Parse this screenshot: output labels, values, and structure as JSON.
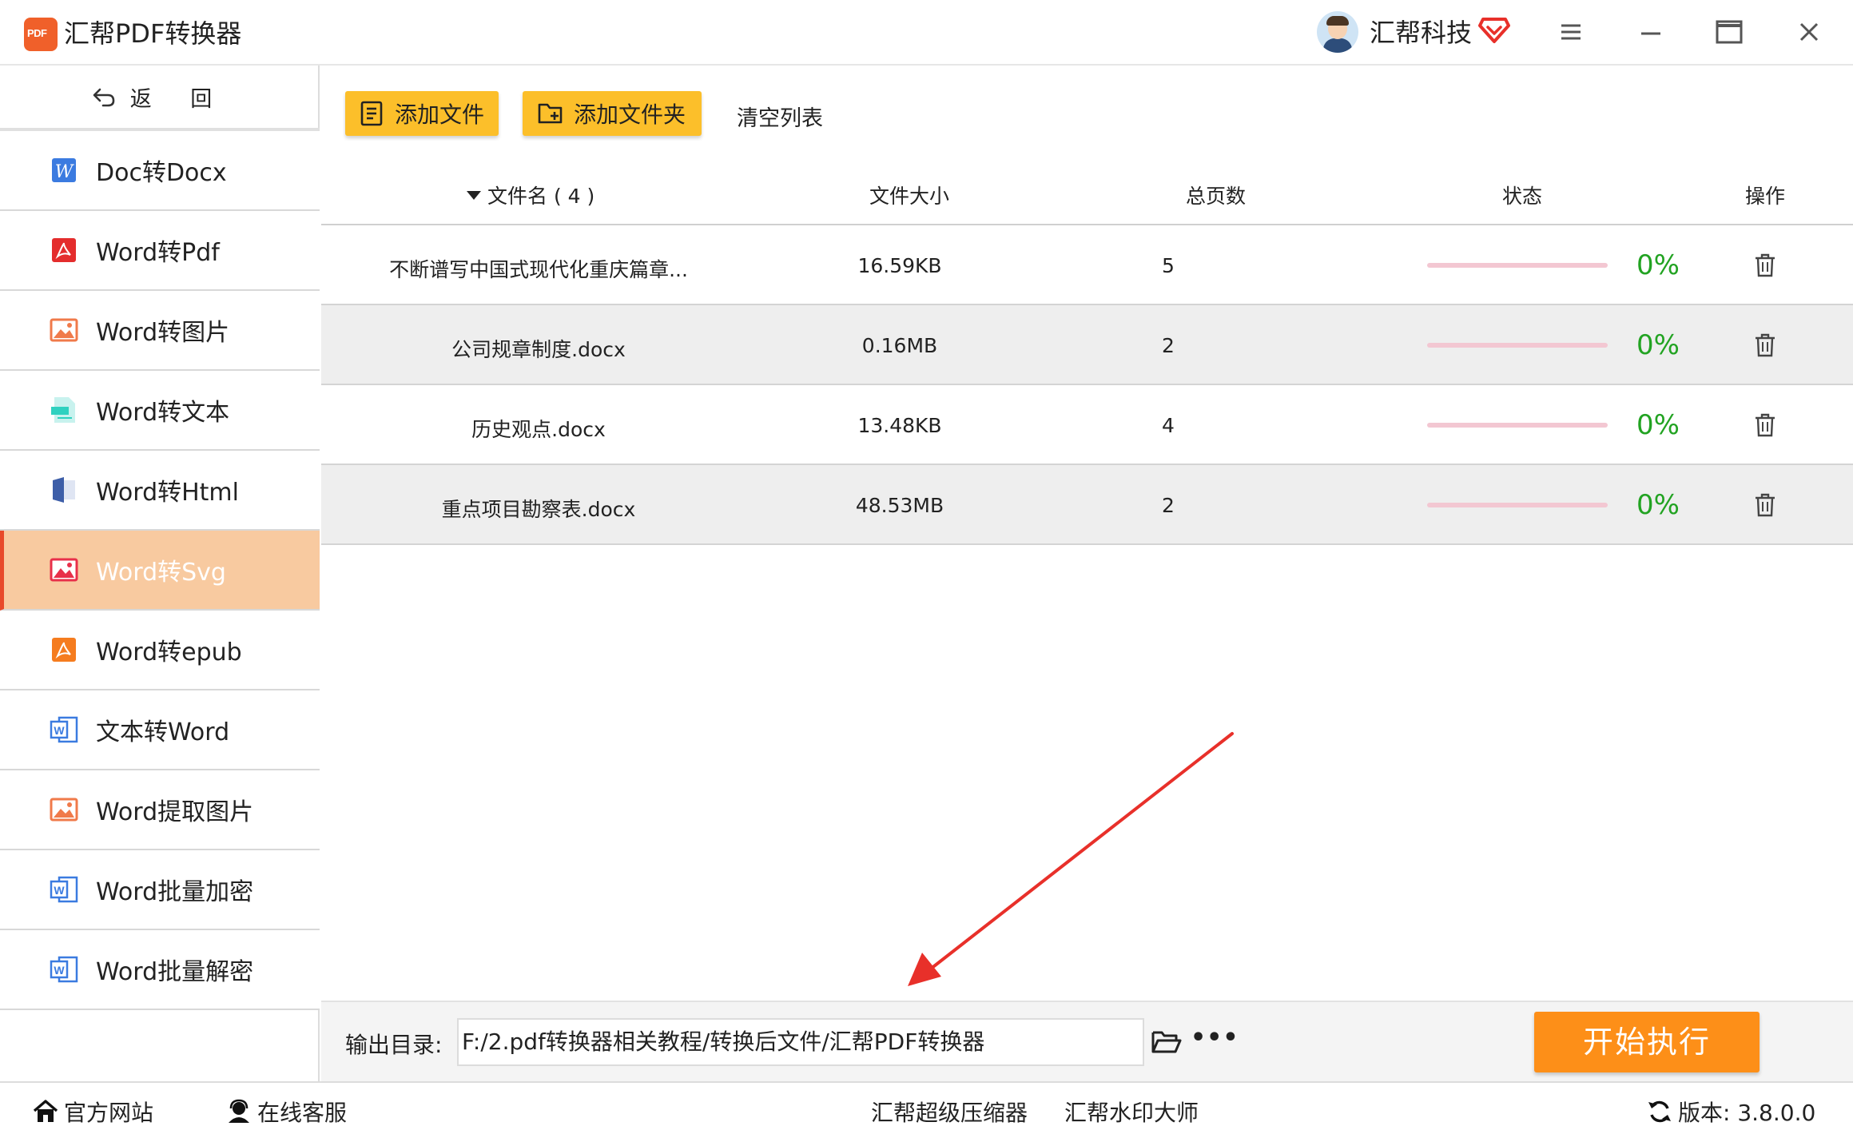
{
  "window": {
    "title": "汇帮PDF转换器",
    "user_name": "汇帮科技",
    "icons": [
      "app-logo-icon",
      "vip-diamond-icon",
      "menu-icon",
      "minimize-icon",
      "maximize-icon",
      "close-icon"
    ]
  },
  "sidebar": {
    "back_label": "返 回",
    "active_index": 5,
    "items": [
      {
        "label": "Doc转Docx",
        "icon": "word-doc-icon"
      },
      {
        "label": "Word转Pdf",
        "icon": "pdf-icon"
      },
      {
        "label": "Word转图片",
        "icon": "image-icon"
      },
      {
        "label": "Word转文本",
        "icon": "text-file-icon"
      },
      {
        "label": "Word转Html",
        "icon": "html-icon"
      },
      {
        "label": "Word转Svg",
        "icon": "svg-image-icon"
      },
      {
        "label": "Word转epub",
        "icon": "epub-icon"
      },
      {
        "label": "文本转Word",
        "icon": "word-icon"
      },
      {
        "label": "Word提取图片",
        "icon": "image-icon"
      },
      {
        "label": "Word批量加密",
        "icon": "word-icon"
      },
      {
        "label": "Word批量解密",
        "icon": "word-icon"
      }
    ]
  },
  "toolbar": {
    "add_file": "添加文件",
    "add_folder": "添加文件夹",
    "clear_list": "清空列表"
  },
  "table": {
    "columns": {
      "name": "文件名 ( 4 )",
      "size": "文件大小",
      "pages": "总页数",
      "status": "状态",
      "action": "操作"
    },
    "rows": [
      {
        "name": "不断谱写中国式现代化重庆篇章...",
        "size": "16.59KB",
        "pages": "5",
        "progress": 0,
        "percent": "0%"
      },
      {
        "name": "公司规章制度.docx",
        "size": "0.16MB",
        "pages": "2",
        "progress": 0,
        "percent": "0%"
      },
      {
        "name": "历史观点.docx",
        "size": "13.48KB",
        "pages": "4",
        "progress": 0,
        "percent": "0%"
      },
      {
        "name": "重点项目勘察表.docx",
        "size": "48.53MB",
        "pages": "2",
        "progress": 0,
        "percent": "0%"
      }
    ]
  },
  "output": {
    "label": "输出目录:",
    "path": "F:/2.pdf转换器相关教程/转换后文件/汇帮PDF转换器",
    "start_button": "开始执行"
  },
  "statusbar": {
    "website": "官方网站",
    "service": "在线客服",
    "compressor": "汇帮超级压缩器",
    "watermark": "汇帮水印大师",
    "version": "版本: 3.8.0.0"
  },
  "colors": {
    "toolbar_button": "#fcbf2a",
    "start_button": "#fd8f18",
    "active_nav": "#f8caa0",
    "percent_text": "#22a322",
    "progress_track": "#f3c7d2",
    "annotation_arrow": "#e8302a"
  }
}
